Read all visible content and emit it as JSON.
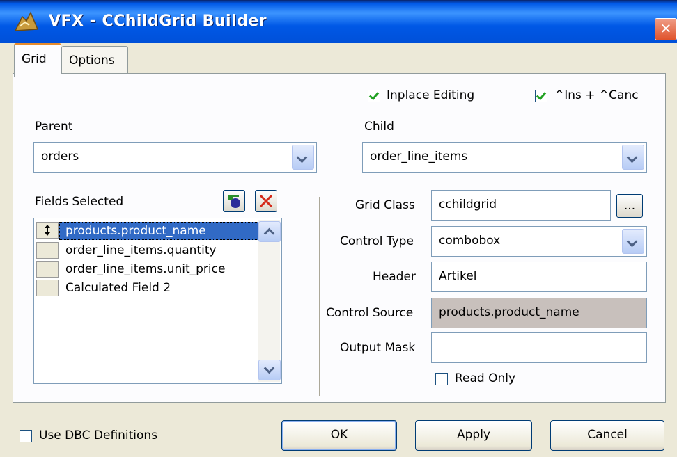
{
  "window": {
    "title": "VFX - CChildGrid Builder",
    "close_glyph": "✕"
  },
  "tabs": [
    {
      "label": "Grid",
      "active": true
    },
    {
      "label": "Options",
      "active": false
    }
  ],
  "options": {
    "inplace_editing": {
      "label": "Inplace Editing",
      "checked": true
    },
    "ins_canc": {
      "label": "^Ins + ^Canc",
      "checked": true
    }
  },
  "parent": {
    "label": "Parent",
    "value": "orders"
  },
  "child": {
    "label": "Child",
    "value": "order_line_items"
  },
  "fields": {
    "label": "Fields Selected",
    "items": [
      {
        "text": "products.product_name",
        "selected": true
      },
      {
        "text": "order_line_items.quantity",
        "selected": false
      },
      {
        "text": "order_line_items.unit_price",
        "selected": false
      },
      {
        "text": "Calculated Field 2",
        "selected": false
      }
    ]
  },
  "properties": {
    "grid_class": {
      "label": "Grid Class",
      "value": "cchildgrid",
      "browse_label": "..."
    },
    "control_type": {
      "label": "Control Type",
      "value": "combobox"
    },
    "header": {
      "label": "Header",
      "value": "Artikel"
    },
    "control_source": {
      "label": "Control Source",
      "value": "products.product_name"
    },
    "output_mask": {
      "label": "Output Mask",
      "value": ""
    },
    "read_only": {
      "label": "Read Only",
      "checked": false
    }
  },
  "footer": {
    "use_dbc": {
      "label": "Use DBC Definitions",
      "checked": false
    },
    "ok_label": "OK",
    "apply_label": "Apply",
    "cancel_label": "Cancel"
  },
  "colors": {
    "selection": "#316ac5",
    "title_bar": "#0058e6",
    "active_tab": "#e68b2c"
  }
}
